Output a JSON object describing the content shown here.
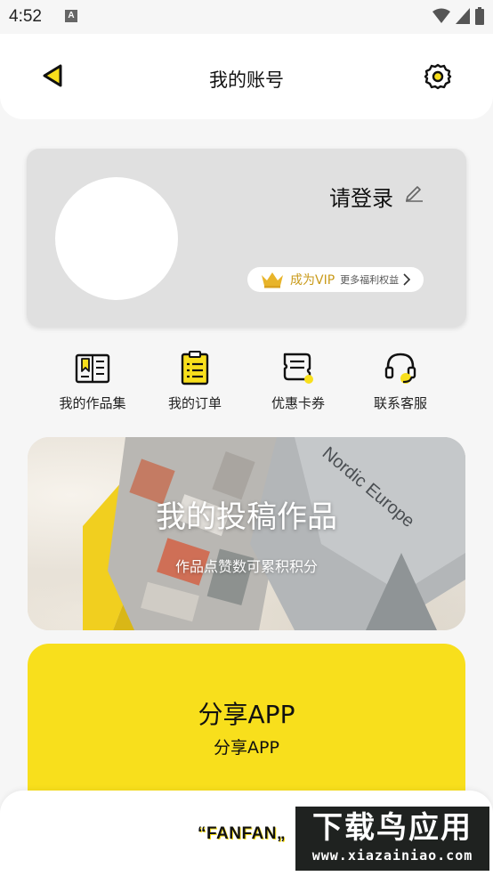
{
  "status_bar": {
    "time": "4:52",
    "a_icon_label": "A"
  },
  "header": {
    "title": "我的账号"
  },
  "profile": {
    "login_label": "请登录",
    "vip_label": "成为VIP",
    "vip_more": "更多福利权益"
  },
  "quick_actions": [
    {
      "label": "我的作品集",
      "icon": "bookmark-book-icon"
    },
    {
      "label": "我的订单",
      "icon": "clipboard-list-icon"
    },
    {
      "label": "优惠卡券",
      "icon": "coupon-icon"
    },
    {
      "label": "联系客服",
      "icon": "headset-icon"
    }
  ],
  "banner": {
    "title": "我的投稿作品",
    "subtitle": "作品点赞数可累积积分",
    "book_title": "Nordic Europe"
  },
  "share": {
    "title": "分享APP",
    "subtitle": "分享APP"
  },
  "bottom": {
    "brand": "“FANFAN„"
  },
  "watermark": {
    "main": "下载鸟应用",
    "url": "www.xiazainiao.com"
  },
  "colors": {
    "accent_yellow": "#f8df1c",
    "vip_gold": "#c99a1a",
    "card_gray": "#e0e0e0"
  }
}
